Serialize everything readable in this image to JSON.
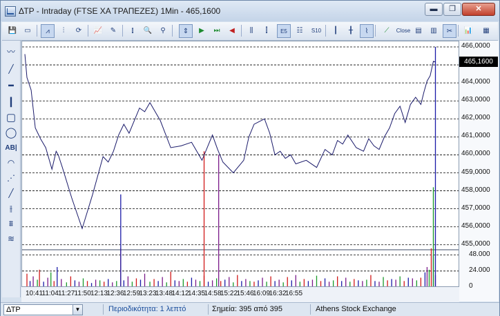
{
  "window": {
    "title": "ΔΤΡ - Intraday (FTSE ΧΑ ΤΡΑΠΕΖΕΣ) 1Min - 465,1600"
  },
  "window_buttons": {
    "minimize": "▬",
    "maximize": "❐",
    "close": "✕"
  },
  "toolbar_icons": [
    "save-icon",
    "window-icon",
    "line-chart-icon",
    "bar-chart-icon",
    "refresh-icon",
    "indicator-icon",
    "drawing-icon",
    "bar-style-icon",
    "zoom-in-icon",
    "zoom-out-icon",
    "scroll-start-icon",
    "play-icon",
    "step-icon",
    "back-icon",
    "chart-type-icon",
    "chart-type-icon",
    "period-icon",
    "template-icon",
    "compare-icon",
    "candle-icon",
    "line-icon",
    "dots-icon",
    "close-icon",
    "layout-icon",
    "panel-icon",
    "tools-icon",
    "export-icon",
    "settings-icon"
  ],
  "toolbar": {
    "close_label": "Close",
    "s10_label": "S10"
  },
  "left_tools": [
    "line-chart-icon",
    "diagonal-line-icon",
    "horizontal-line-icon",
    "vertical-line-icon",
    "rectangle-icon",
    "ellipse-icon",
    "text-icon",
    "arc-icon",
    "fan-icon",
    "trendline-icon",
    "channel-icon",
    "fibonacci-icon",
    "wave-icon"
  ],
  "text_tool_label": "ΑΒ|",
  "status": {
    "symbol": "ΔΤΡ",
    "periodicity": "Περιοδικότητα: 1 λεπτό",
    "points": "Σημεία: 395 από 395",
    "exchange": "Athens Stock Exchange"
  },
  "last_price_label": "465,1600",
  "chart_data": {
    "type": "line",
    "price_axis": {
      "ticks": [
        "466,0000",
        "465,0000",
        "464,0000",
        "463,0000",
        "462,0000",
        "461,0000",
        "460,0000",
        "459,0000",
        "458,0000",
        "457,0000",
        "456,0000",
        "455,0000"
      ],
      "ylim": [
        454.8,
        466.0
      ],
      "last_price": 465.16
    },
    "volume_axis": {
      "ticks": [
        "48.000",
        "24.000",
        "0"
      ],
      "ylim": [
        0,
        58000
      ]
    },
    "x_ticks": [
      "10:41",
      "11:04",
      "11:27",
      "11:50",
      "12:13",
      "12:36",
      "12:59",
      "13:23",
      "13:48",
      "14:12",
      "14:35",
      "14:58",
      "15:22",
      "15:46",
      "16:09",
      "16:32",
      "16:55"
    ],
    "price_series": {
      "x": [
        0,
        2,
        6,
        10,
        15,
        20,
        26,
        30,
        32,
        36,
        45,
        55,
        65,
        75,
        80,
        85,
        90,
        95,
        100,
        110,
        115,
        120,
        130,
        140,
        150,
        160,
        170,
        180,
        185,
        190,
        200,
        210,
        215,
        220,
        230,
        235,
        240,
        245,
        250,
        255,
        260,
        270,
        280,
        288,
        295,
        300,
        305,
        310,
        318,
        325,
        330,
        335,
        340,
        345,
        350,
        355,
        360,
        365,
        370,
        375,
        380,
        383,
        386,
        389,
        392,
        394
      ],
      "y": [
        465.6,
        464.3,
        463.6,
        461.5,
        460.9,
        460.4,
        459.2,
        460.2,
        460.0,
        459.3,
        457.6,
        455.9,
        457.8,
        459.9,
        459.6,
        460.2,
        461.1,
        461.7,
        461.2,
        462.6,
        462.4,
        462.9,
        461.9,
        460.4,
        460.5,
        460.7,
        459.7,
        461.1,
        460.3,
        459.6,
        459.0,
        459.7,
        461.0,
        461.7,
        462.0,
        461.2,
        460.0,
        460.2,
        459.8,
        460.0,
        459.5,
        459.7,
        459.3,
        460.3,
        460.0,
        460.8,
        460.6,
        461.1,
        460.4,
        460.2,
        460.9,
        460.5,
        460.3,
        461.0,
        461.5,
        462.3,
        462.7,
        461.8,
        462.8,
        463.2,
        462.8,
        463.5,
        464.1,
        464.4,
        465.2,
        465.16
      ]
    },
    "volume_series": {
      "x": [
        2,
        5,
        8,
        12,
        14,
        18,
        22,
        25,
        28,
        31,
        35,
        40,
        44,
        48,
        52,
        56,
        60,
        64,
        68,
        72,
        76,
        80,
        84,
        88,
        92,
        95,
        99,
        103,
        107,
        111,
        115,
        120,
        124,
        128,
        132,
        136,
        140,
        144,
        148,
        152,
        156,
        160,
        164,
        168,
        172,
        176,
        180,
        184,
        188,
        192,
        196,
        200,
        204,
        208,
        212,
        216,
        220,
        224,
        228,
        232,
        236,
        240,
        244,
        248,
        252,
        256,
        260,
        264,
        268,
        272,
        276,
        280,
        284,
        288,
        292,
        296,
        300,
        304,
        308,
        312,
        316,
        320,
        324,
        328,
        332,
        336,
        340,
        344,
        348,
        352,
        356,
        360,
        364,
        368,
        372,
        376,
        380,
        384,
        386,
        388,
        390,
        392,
        394
      ],
      "y": [
        20000,
        9000,
        16000,
        11000,
        26000,
        8000,
        14000,
        22000,
        9000,
        30000,
        12000,
        7000,
        16000,
        10000,
        8000,
        13000,
        9000,
        6000,
        11000,
        10000,
        8000,
        12000,
        7000,
        9000,
        58000,
        10000,
        16000,
        8000,
        13000,
        11000,
        20000,
        8000,
        12000,
        9000,
        15000,
        7000,
        23000,
        10000,
        9000,
        12000,
        8000,
        14000,
        11000,
        9000,
        17000,
        8000,
        10000,
        13000,
        9000,
        11000,
        15000,
        7000,
        18000,
        9000,
        12000,
        9000,
        8000,
        10000,
        14000,
        8000,
        16000,
        9000,
        11000,
        7000,
        15000,
        10000,
        18000,
        8000,
        12000,
        9000,
        11000,
        17000,
        9000,
        13000,
        8000,
        10000,
        16000,
        9000,
        14000,
        8000,
        12000,
        10000,
        9000,
        11000,
        18000,
        9000,
        8000,
        15000,
        10000,
        12000,
        11000,
        16000,
        9000,
        14000,
        13000,
        10000,
        14000,
        22000,
        30000,
        26000,
        58000,
        48000,
        18000
      ],
      "colors": [
        "red",
        "blue",
        "purple",
        "green"
      ]
    },
    "high_spike_price": 464.3,
    "grid": "horizontal dashed"
  }
}
